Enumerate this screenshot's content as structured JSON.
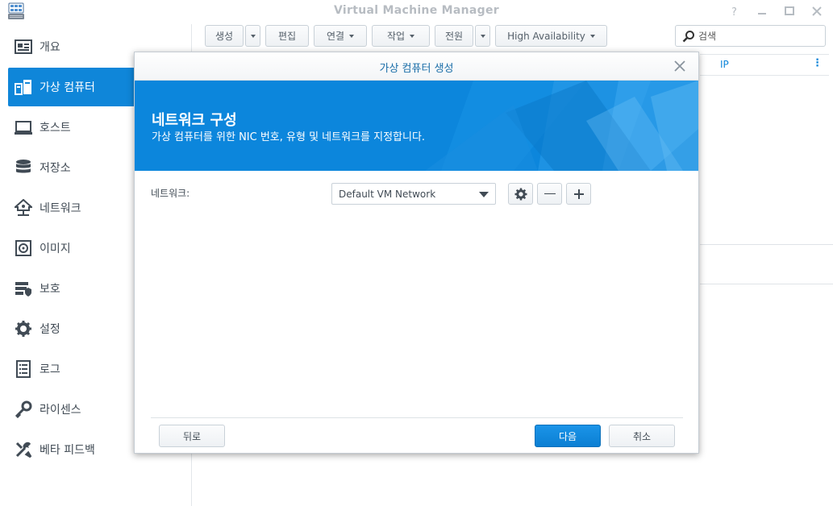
{
  "window": {
    "title": "Virtual Machine Manager"
  },
  "sidebar": {
    "items": [
      {
        "label": "개요",
        "icon": "overview-icon"
      },
      {
        "label": "가상 컴퓨터",
        "icon": "virtual-machine-icon",
        "active": true
      },
      {
        "label": "호스트",
        "icon": "host-icon"
      },
      {
        "label": "저장소",
        "icon": "storage-icon"
      },
      {
        "label": "네트워크",
        "icon": "network-icon"
      },
      {
        "label": "이미지",
        "icon": "image-icon"
      },
      {
        "label": "보호",
        "icon": "protection-icon"
      },
      {
        "label": "설정",
        "icon": "settings-icon"
      },
      {
        "label": "로그",
        "icon": "log-icon"
      },
      {
        "label": "라이센스",
        "icon": "license-icon"
      },
      {
        "label": "베타 피드백",
        "icon": "feedback-icon"
      }
    ]
  },
  "toolbar": {
    "create": "생성",
    "edit": "편집",
    "connect": "연결",
    "action": "작업",
    "power": "전원",
    "high_availability": "High Availability"
  },
  "search": {
    "placeholder": "검색"
  },
  "list": {
    "col_ip": "IP"
  },
  "dialog": {
    "title": "가상 컴퓨터 생성",
    "heading": "네트워크 구성",
    "subheading": "가상 컴퓨터를 위한 NIC 번호, 유형 및 네트워크를 지정합니다.",
    "network_label": "네트워크:",
    "network_value": "Default VM Network",
    "back": "뒤로",
    "next": "다음",
    "cancel": "취소"
  },
  "colors": {
    "accent": "#0f86d9",
    "banner": "#0c86dc"
  }
}
